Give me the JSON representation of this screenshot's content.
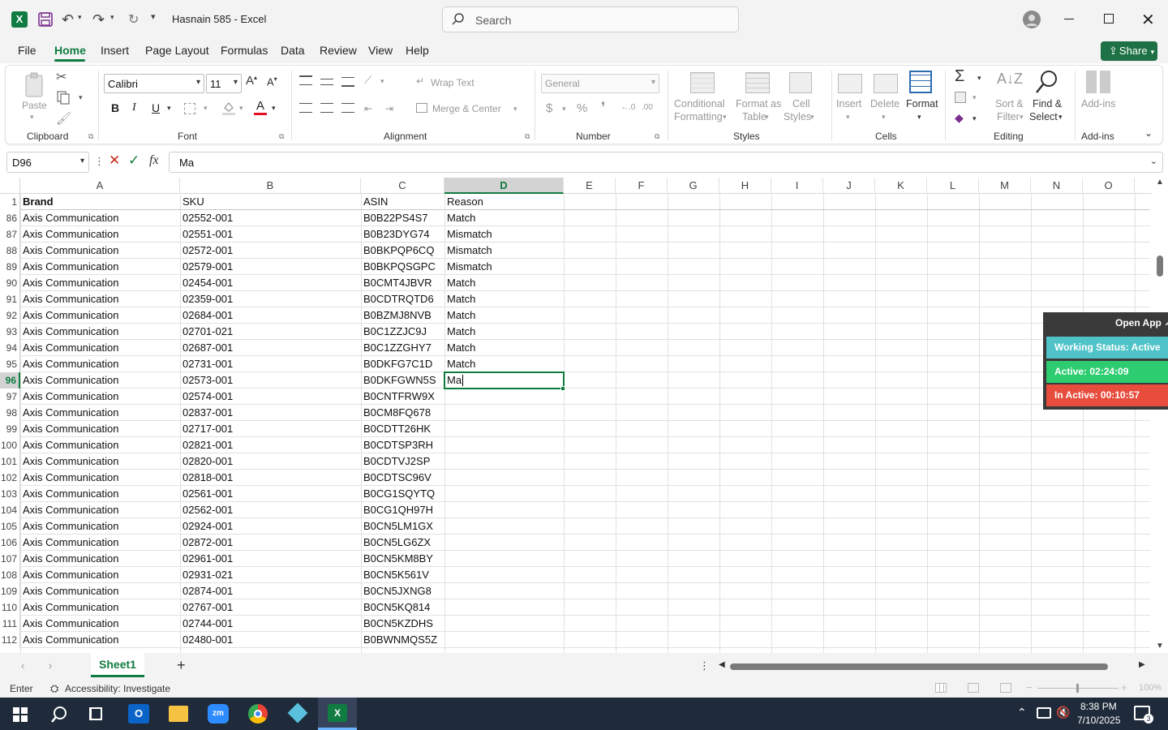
{
  "app": {
    "title": "Hasnain 585  -  Excel",
    "search_placeholder": "Search"
  },
  "ribbon_tabs": [
    "File",
    "Home",
    "Insert",
    "Page Layout",
    "Formulas",
    "Data",
    "Review",
    "View",
    "Help"
  ],
  "share_label": "Share",
  "ribbon": {
    "paste": "Paste",
    "font_name": "Calibri",
    "font_size": "11",
    "wrap_text": "Wrap Text",
    "merge_center": "Merge & Center",
    "number_format": "General",
    "conditional": [
      "Conditional",
      "Formatting"
    ],
    "format_as": [
      "Format as",
      "Table"
    ],
    "cell_styles": [
      "Cell",
      "Styles"
    ],
    "insert": "Insert",
    "delete": "Delete",
    "format": "Format",
    "sort": [
      "Sort &",
      "Filter"
    ],
    "find": [
      "Find &",
      "Select"
    ],
    "addins": "Add-ins",
    "groups": [
      "Clipboard",
      "Font",
      "Alignment",
      "Number",
      "Styles",
      "Cells",
      "Editing",
      "Add-ins"
    ]
  },
  "formula_bar": {
    "name_box": "D96",
    "content": "Ma"
  },
  "columns": [
    "A",
    "B",
    "C",
    "D",
    "E",
    "F",
    "G",
    "H",
    "I",
    "J",
    "K",
    "L",
    "M",
    "N",
    "O"
  ],
  "header_row": {
    "num": "1",
    "cells": [
      "Brand",
      "SKU",
      "ASIN",
      "Reason"
    ]
  },
  "rows": [
    {
      "num": "86",
      "brand": "Axis Communication",
      "sku": "02552-001",
      "asin": "B0B22PS4S7",
      "reason": "Match"
    },
    {
      "num": "87",
      "brand": "Axis Communication",
      "sku": "02551-001",
      "asin": "B0B23DYG74",
      "reason": "Mismatch"
    },
    {
      "num": "88",
      "brand": "Axis Communication",
      "sku": "02572-001",
      "asin": "B0BKPQP6CQ",
      "reason": "Mismatch"
    },
    {
      "num": "89",
      "brand": "Axis Communication",
      "sku": "02579-001",
      "asin": "B0BKPQSGPC",
      "reason": "Mismatch"
    },
    {
      "num": "90",
      "brand": "Axis Communication",
      "sku": "02454-001",
      "asin": "B0CMT4JBVR",
      "reason": "Match"
    },
    {
      "num": "91",
      "brand": "Axis Communication",
      "sku": "02359-001",
      "asin": "B0CDTRQTD6",
      "reason": "Match"
    },
    {
      "num": "92",
      "brand": "Axis Communication",
      "sku": "02684-001",
      "asin": "B0BZMJ8NVB",
      "reason": "Match"
    },
    {
      "num": "93",
      "brand": "Axis Communication",
      "sku": "02701-021",
      "asin": "B0C1ZZJC9J",
      "reason": "Match"
    },
    {
      "num": "94",
      "brand": "Axis Communication",
      "sku": "02687-001",
      "asin": "B0C1ZZGHY7",
      "reason": "Match"
    },
    {
      "num": "95",
      "brand": "Axis Communication",
      "sku": "02731-001",
      "asin": "B0DKFG7C1D",
      "reason": "Match"
    },
    {
      "num": "96",
      "brand": "Axis Communication",
      "sku": "02573-001",
      "asin": "B0DKFGWN5S",
      "reason": "Ma"
    },
    {
      "num": "97",
      "brand": "Axis Communication",
      "sku": "02574-001",
      "asin": "B0CNTFRW9X",
      "reason": ""
    },
    {
      "num": "98",
      "brand": "Axis Communication",
      "sku": "02837-001",
      "asin": "B0CM8FQ678",
      "reason": ""
    },
    {
      "num": "99",
      "brand": "Axis Communication",
      "sku": "02717-001",
      "asin": "B0CDTT26HK",
      "reason": ""
    },
    {
      "num": "100",
      "brand": "Axis Communication",
      "sku": "02821-001",
      "asin": "B0CDTSP3RH",
      "reason": ""
    },
    {
      "num": "101",
      "brand": "Axis Communication",
      "sku": "02820-001",
      "asin": "B0CDTVJ2SP",
      "reason": ""
    },
    {
      "num": "102",
      "brand": "Axis Communication",
      "sku": "02818-001",
      "asin": "B0CDTSC96V",
      "reason": ""
    },
    {
      "num": "103",
      "brand": "Axis Communication",
      "sku": "02561-001",
      "asin": "B0CG1SQYTQ",
      "reason": ""
    },
    {
      "num": "104",
      "brand": "Axis Communication",
      "sku": "02562-001",
      "asin": "B0CG1QH97H",
      "reason": ""
    },
    {
      "num": "105",
      "brand": "Axis Communication",
      "sku": "02924-001",
      "asin": "B0CN5LM1GX",
      "reason": ""
    },
    {
      "num": "106",
      "brand": "Axis Communication",
      "sku": "02872-001",
      "asin": "B0CN5LG6ZX",
      "reason": ""
    },
    {
      "num": "107",
      "brand": "Axis Communication",
      "sku": "02961-001",
      "asin": "B0CN5KM8BY",
      "reason": ""
    },
    {
      "num": "108",
      "brand": "Axis Communication",
      "sku": "02931-021",
      "asin": "B0CN5K561V",
      "reason": ""
    },
    {
      "num": "109",
      "brand": "Axis Communication",
      "sku": "02874-001",
      "asin": "B0CN5JXNG8",
      "reason": ""
    },
    {
      "num": "110",
      "brand": "Axis Communication",
      "sku": "02767-001",
      "asin": "B0CN5KQ814",
      "reason": ""
    },
    {
      "num": "111",
      "brand": "Axis Communication",
      "sku": "02744-001",
      "asin": "B0CN5KZDHS",
      "reason": ""
    },
    {
      "num": "112",
      "brand": "Axis Communication",
      "sku": "02480-001",
      "asin": "B0BWNMQS5Z",
      "reason": ""
    }
  ],
  "sheet_tab": "Sheet1",
  "status": {
    "mode": "Enter",
    "accessibility": "Accessibility: Investigate",
    "zoom": "100%"
  },
  "widget": {
    "open_app": "Open App ↗",
    "working": "Working Status: Active",
    "active": "Active: 02:24:09",
    "inactive": "In Active: 00:10:57"
  },
  "taskbar": {
    "time": "8:38 PM",
    "date": "7/10/2025",
    "notif_count": "3"
  },
  "colors": {
    "excel_green": "#107c41",
    "accent_green": "#1e7145",
    "widget_teal": "#4fc3c8",
    "widget_green": "#2ecc71",
    "widget_red": "#e74c3c"
  }
}
